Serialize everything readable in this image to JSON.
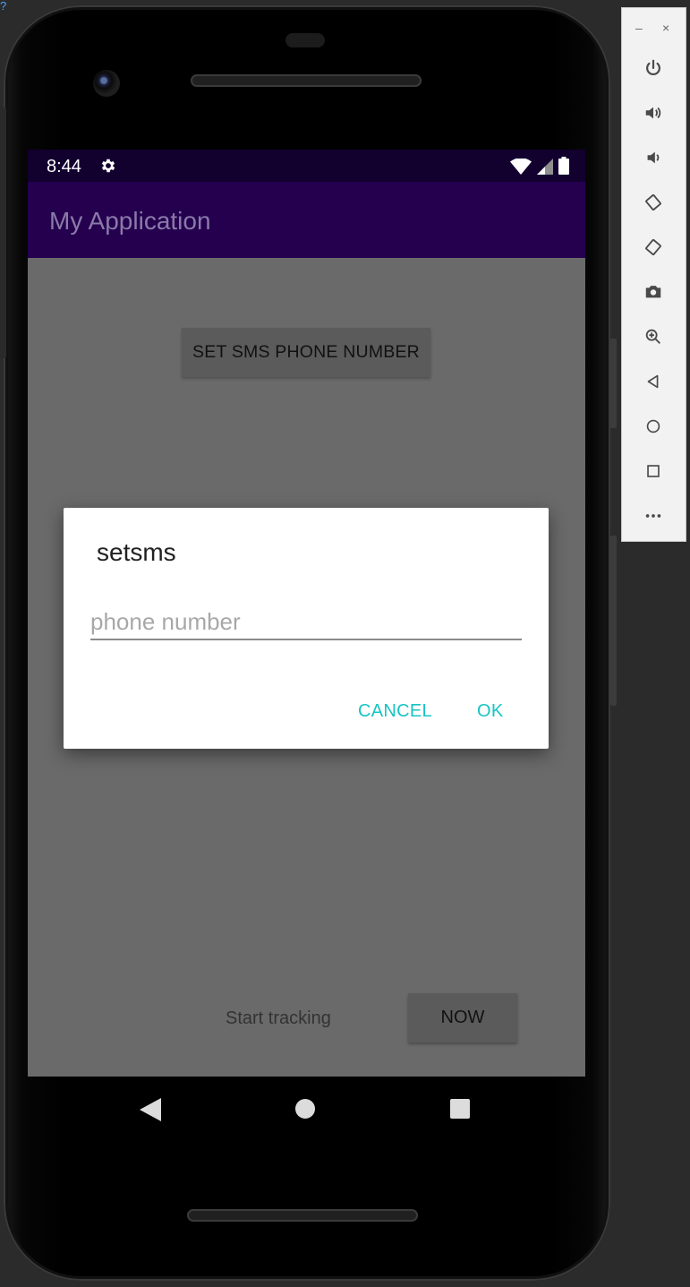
{
  "corner_glyph": "?",
  "status_bar": {
    "time": "8:44"
  },
  "app_bar": {
    "title": "My Application"
  },
  "main": {
    "set_sms_button": "SET SMS PHONE NUMBER",
    "start_tracking_label": "Start tracking",
    "now_button": "NOW"
  },
  "dialog": {
    "title": "setsms",
    "input_placeholder": "phone number",
    "input_value": "",
    "cancel_label": "CANCEL",
    "ok_label": "OK"
  },
  "emulator_toolbar": {
    "minimize_label": "–",
    "close_label": "×",
    "tools": [
      "power-icon",
      "volume-up-icon",
      "volume-down-icon",
      "rotate-left-icon",
      "rotate-right-icon",
      "screenshot-icon",
      "zoom-icon",
      "back-icon",
      "home-icon",
      "overview-icon",
      "more-icon"
    ]
  },
  "colors": {
    "status_bar": "#12002f",
    "app_bar": "#24004f",
    "dialog_accent": "#17c4c4",
    "screen_scrim": "#6a6a6a"
  }
}
